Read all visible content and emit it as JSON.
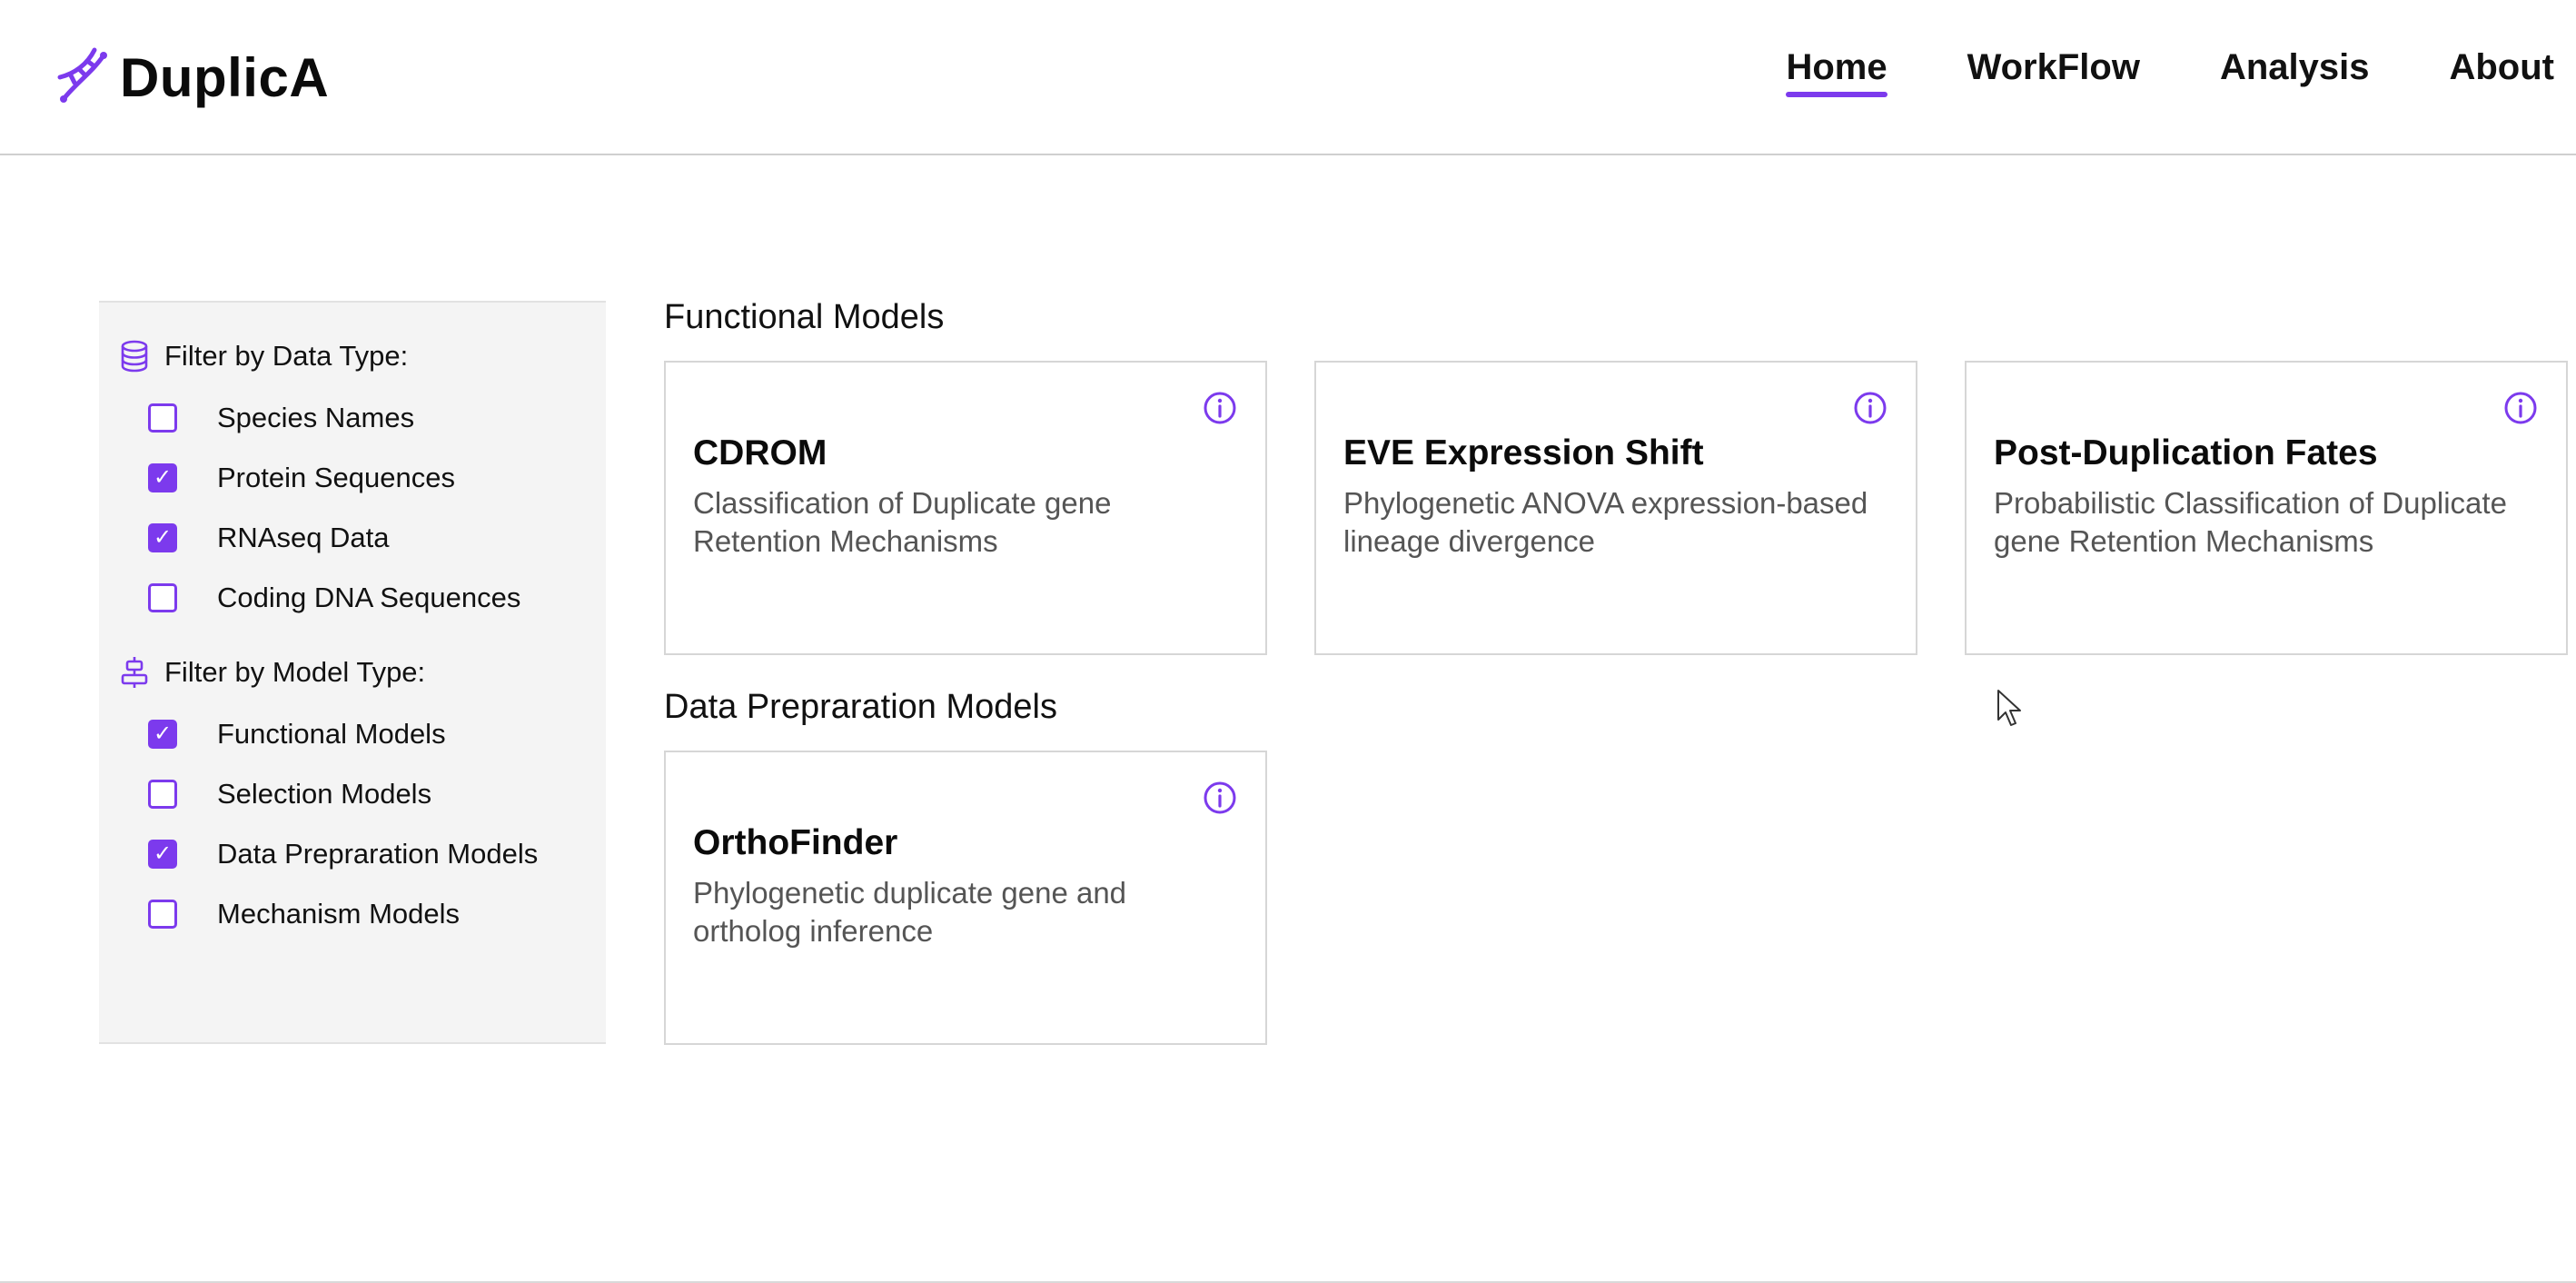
{
  "app": {
    "logo_text": "DuplicA",
    "logo_icon": "dna-icon",
    "accent_color": "#7c3aed"
  },
  "nav": {
    "items": [
      {
        "label": "Home",
        "active": true
      },
      {
        "label": "WorkFlow",
        "active": false
      },
      {
        "label": "Analysis",
        "active": false
      },
      {
        "label": "About",
        "active": false
      }
    ]
  },
  "sidebar": {
    "data_type": {
      "heading": "Filter by Data Type:",
      "icon": "database-icon",
      "options": [
        {
          "label": "Species Names",
          "checked": false
        },
        {
          "label": "Protein Sequences",
          "checked": true
        },
        {
          "label": "RNAseq Data",
          "checked": true
        },
        {
          "label": "Coding DNA Sequences",
          "checked": false
        }
      ]
    },
    "model_type": {
      "heading": "Filter by Model Type:",
      "icon": "align-center-icon",
      "options": [
        {
          "label": "Functional Models",
          "checked": true
        },
        {
          "label": "Selection Models",
          "checked": false
        },
        {
          "label": "Data Prepraration Models",
          "checked": true
        },
        {
          "label": "Mechanism Models",
          "checked": false
        }
      ]
    }
  },
  "sections": [
    {
      "title": "Functional Models",
      "cards": [
        {
          "title": "CDROM",
          "description": "Classification of Duplicate gene Retention Mechanisms"
        },
        {
          "title": "EVE Expression Shift",
          "description": "Phylogenetic ANOVA expression-based lineage divergence"
        },
        {
          "title": "Post-Duplication Fates",
          "description": "Probabilistic Classification of Duplicate gene Retention Mechanisms"
        }
      ]
    },
    {
      "title": "Data Prepraration Models",
      "cards": [
        {
          "title": "OrthoFinder",
          "description": "Phylogenetic duplicate gene and ortholog inference"
        }
      ]
    }
  ]
}
